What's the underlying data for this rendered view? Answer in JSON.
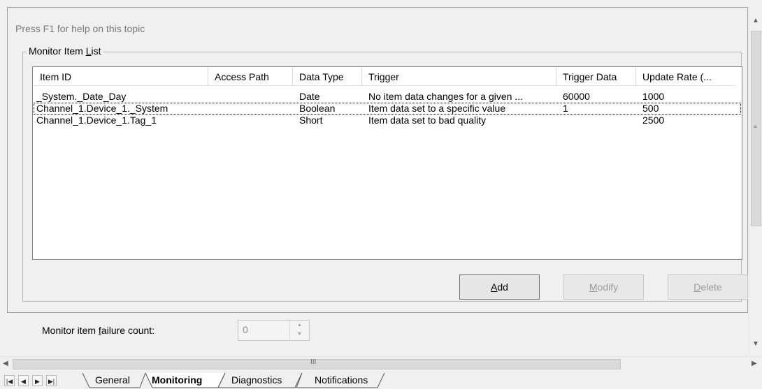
{
  "help_text": "Press F1 for help on this topic",
  "monitor_list": {
    "label_pre": "Monitor Item ",
    "label_mnemonic": "L",
    "label_post": "ist",
    "columns": [
      "Item ID",
      "Access Path",
      "Data Type",
      "Trigger",
      "Trigger Data",
      "Update Rate (..."
    ],
    "rows": [
      {
        "item_id": "_System._Date_Day",
        "access_path": "",
        "data_type": "Date",
        "trigger": "No item data changes for a given ...",
        "trigger_data": "60000",
        "update_rate": "1000"
      },
      {
        "item_id": "Channel_1.Device_1._System",
        "access_path": "",
        "data_type": "Boolean",
        "trigger": "Item data set to a specific value",
        "trigger_data": "1",
        "update_rate": "500"
      },
      {
        "item_id": "Channel_1.Device_1.Tag_1",
        "access_path": "",
        "data_type": "Short",
        "trigger": "Item data set to bad quality",
        "trigger_data": "",
        "update_rate": "2500"
      }
    ]
  },
  "buttons": {
    "add_mnemonic": "A",
    "add_rest": "dd",
    "modify_mnemonic": "M",
    "modify_rest": "odify",
    "delete_mnemonic": "D",
    "delete_rest": "elete"
  },
  "failure_count": {
    "label_pre": "Monitor item ",
    "label_mnemonic": "f",
    "label_post": "ailure count:",
    "value": "0"
  },
  "tabs": [
    "General",
    "Monitoring",
    "Diagnostics",
    "Notifications"
  ],
  "active_tab": "Monitoring",
  "scroll_grip": "III"
}
